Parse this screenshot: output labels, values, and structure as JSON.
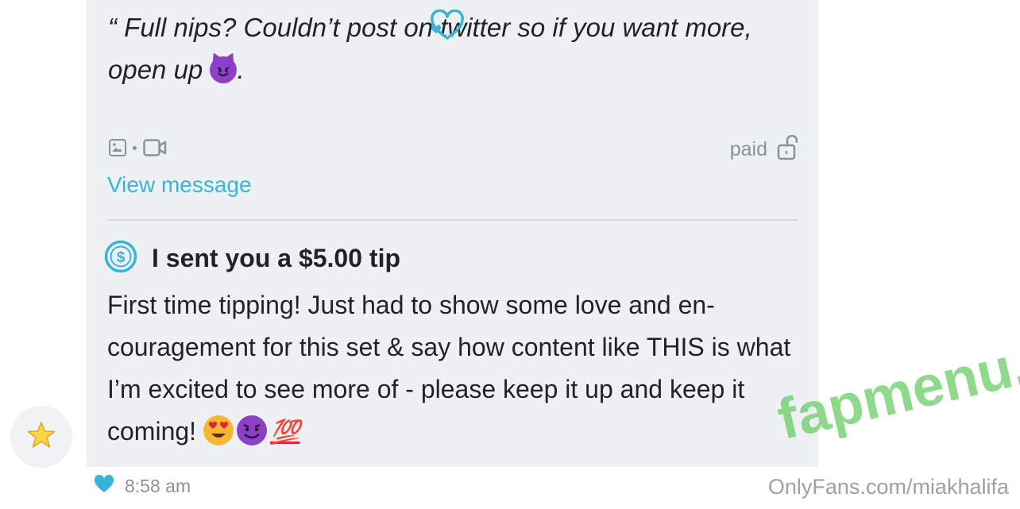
{
  "message": {
    "quote_text": "“ Full nips? Couldn’t post on twitter so if you want more, open up",
    "quote_end": ".",
    "media_status": "paid",
    "view_link": "View message"
  },
  "tip": {
    "title": "I sent you a $5.00 tip",
    "body": "First time tipping! Just had to show some love and en-couragement for this set & say how content like THIS is what I’m excited to see more of - please keep it up and keep it coming!",
    "emoji_hundred": "💯"
  },
  "footer": {
    "time": "8:58 am"
  },
  "watermarks": {
    "site": "fapmenu.com",
    "credit": "OnlyFans.com/miakhalifa"
  },
  "colors": {
    "accent": "#3ab3d8",
    "bubble_bg": "#eef1f4",
    "muted": "#8a9299",
    "watermark_green": "#6fcf6b"
  },
  "icons": [
    "image-icon",
    "video-icon",
    "unlock-icon",
    "dollar-circle-icon",
    "heart-outline-icon",
    "star-icon",
    "heart-icon",
    "devil-emoji",
    "heart-eyes-emoji",
    "hundred-emoji"
  ]
}
